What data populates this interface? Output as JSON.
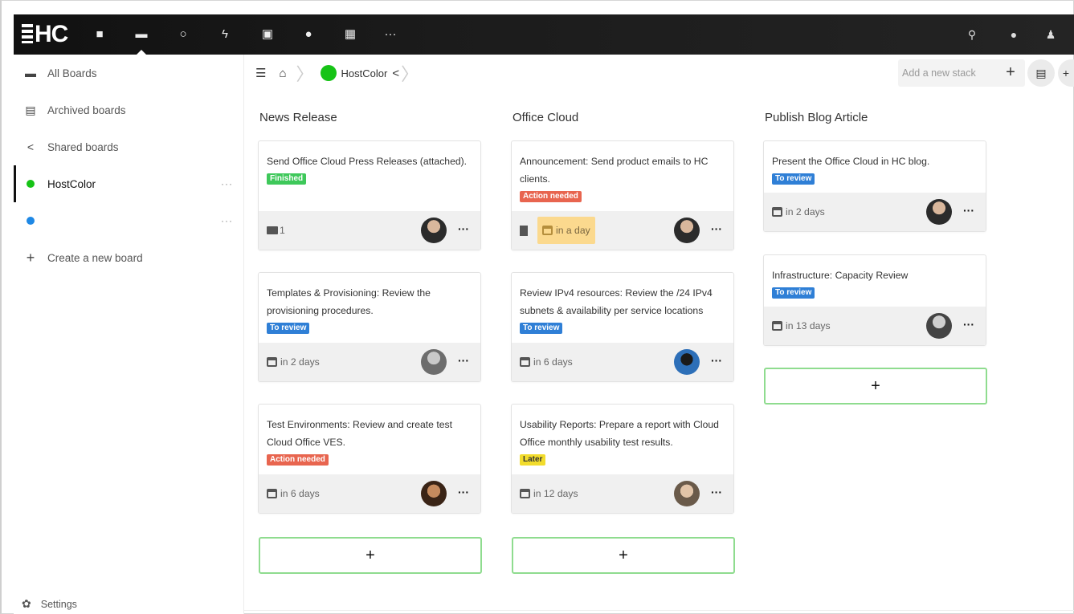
{
  "topbar": {
    "logo": "HC",
    "nav_icons": [
      "files-icon",
      "deck-icon",
      "search-circle-icon",
      "activity-icon",
      "gallery-icon",
      "contacts-icon",
      "calendar-icon",
      "more-icon"
    ],
    "right_icons": [
      "search-icon",
      "notifications-icon",
      "user-icon"
    ]
  },
  "sidebar": {
    "items": [
      {
        "label": "All Boards",
        "icon": "boards-icon"
      },
      {
        "label": "Archived boards",
        "icon": "archive-icon"
      },
      {
        "label": "Shared boards",
        "icon": "share-icon"
      },
      {
        "label": "HostColor",
        "color": "#16c316",
        "more": "···"
      },
      {
        "label": "",
        "color": "#1e88e5",
        "more": "···"
      },
      {
        "label": "Create a new board",
        "icon": "plus-icon"
      }
    ],
    "settings_label": "Settings"
  },
  "header": {
    "board_name": "HostColor",
    "add_stack_placeholder": "Add a new stack",
    "plus": "+"
  },
  "stacks": [
    {
      "title": "News Release",
      "cards": [
        {
          "text": "Send Office Cloud Press Releases (attached).",
          "label": "Finished",
          "label_color": "#3ec85a",
          "attachments": "1",
          "due": "",
          "avatar_color": "#2b2b2b",
          "more": "···"
        },
        {
          "text": "Templates & Provisioning: Review the provisioning procedures.",
          "label": "To review",
          "label_color": "#2f7fd6",
          "due": "in 2 days",
          "avatar_color": "#6d6d6d",
          "more": "···"
        },
        {
          "text": "Test Environments: Review and create test Cloud Office VES.",
          "label": "Action needed",
          "label_color": "#e8654f",
          "due": "in 6 days",
          "avatar_color": "#5a3a22",
          "more": "···"
        }
      ],
      "add": "+"
    },
    {
      "title": "Office Cloud",
      "cards": [
        {
          "text": "Announcement: Send product emails to HC clients.",
          "label": "Action needed",
          "label_color": "#e8654f",
          "due": "in a day",
          "due_warn": true,
          "avatar_color": "#2b2b2b",
          "more": "···"
        },
        {
          "text": "Review IPv4 resources: Review the /24 IPv4 subnets & availability per service locations",
          "label": "To review",
          "label_color": "#2f7fd6",
          "due": "in 6 days",
          "avatar_color": "#2d6fb8",
          "more": "···"
        },
        {
          "text": "Usability Reports: Prepare a report with Cloud Office monthly usability test results.",
          "label": "Later",
          "label_color": "#f2dc2c",
          "label_text_color": "#333",
          "due": "in 12 days",
          "avatar_color": "#b89a7a",
          "more": "···"
        }
      ],
      "add": "+"
    },
    {
      "title": "Publish Blog Article",
      "cards": [
        {
          "text": "Present the Office Cloud in HC blog.",
          "label": "To review",
          "label_color": "#2f7fd6",
          "due": "in 2 days",
          "avatar_color": "#2b2b2b",
          "more": "···"
        },
        {
          "text": "Infrastructure: Capacity Review",
          "label": "To review",
          "label_color": "#2f7fd6",
          "due": "in 13 days",
          "avatar_color": "#444444",
          "more": "···"
        }
      ],
      "add": "+"
    }
  ]
}
